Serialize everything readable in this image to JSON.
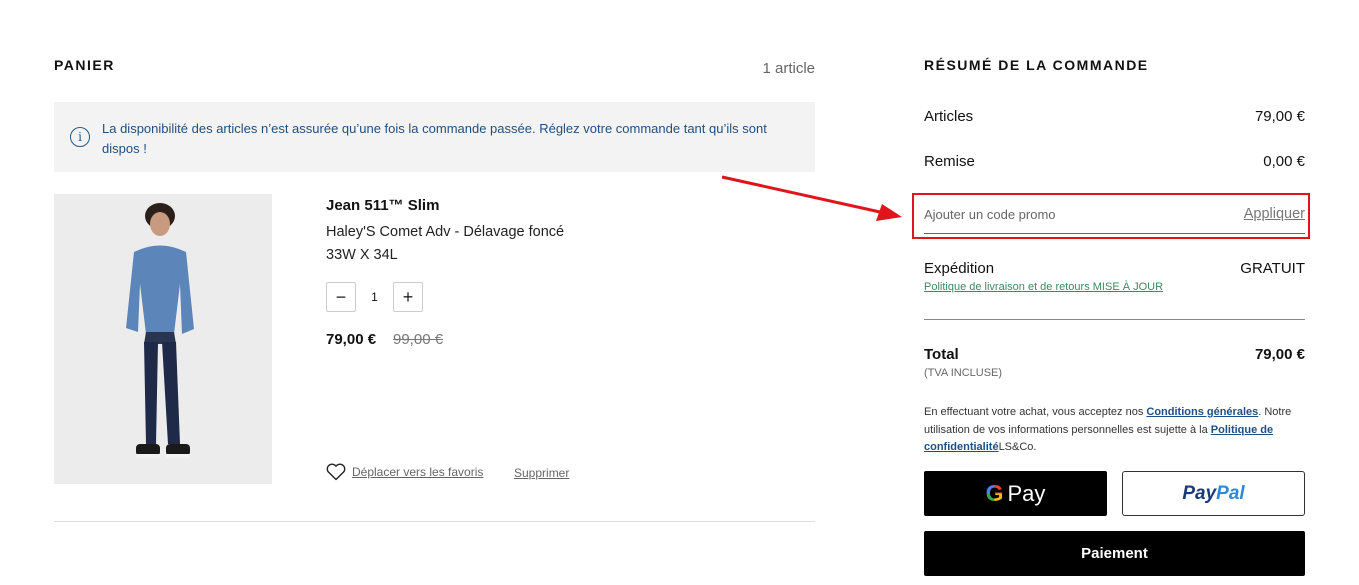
{
  "cart": {
    "title": "PANIER",
    "count": "1 article",
    "notice": "La disponibilité des articles n’est assurée qu’une fois la commande passée. Réglez votre commande tant qu’ils sont dispos !",
    "item": {
      "name": "Jean 511™ Slim",
      "description": "Haley'S Comet Adv - Délavage foncé",
      "size": "33W X 34L",
      "quantity": "1",
      "price": "79,00 €",
      "old_price": "99,00 €",
      "favorite_label": "Déplacer vers les favoris",
      "remove_label": "Supprimer"
    }
  },
  "summary": {
    "title": "RÉSUMÉ DE LA COMMANDE",
    "articles_label": "Articles",
    "articles_value": "79,00 €",
    "remise_label": "Remise",
    "remise_value": "0,00 €",
    "promo_placeholder": "Ajouter un code promo",
    "promo_apply": "Appliquer",
    "shipping_label": "Expédition",
    "shipping_value": "GRATUIT",
    "shipping_link": "Politique de livraison et de retours MISE À JOUR",
    "total_label": "Total",
    "total_value": "79,00 €",
    "tva": "(TVA INCLUSE)",
    "legal_1": "En effectuant votre achat, vous acceptez nos ",
    "legal_link_1": "Conditions générales",
    "legal_2": ". Notre utilisation de vos informations personnelles est sujette à la ",
    "legal_link_2": "Politique de confidentialité",
    "legal_3": "LS&Co.",
    "gpay_g": "G",
    "gpay_label": "Pay",
    "paypal_1": "Pay",
    "paypal_2": "Pal",
    "checkout_label": "Paiement"
  },
  "colors": {
    "highlight": "#e0151b",
    "link_blue": "#1f4f82",
    "link_green": "#3d8a62"
  },
  "icons": [
    "info-icon",
    "minus-icon",
    "plus-icon",
    "heart-icon",
    "arrow-annotation"
  ]
}
